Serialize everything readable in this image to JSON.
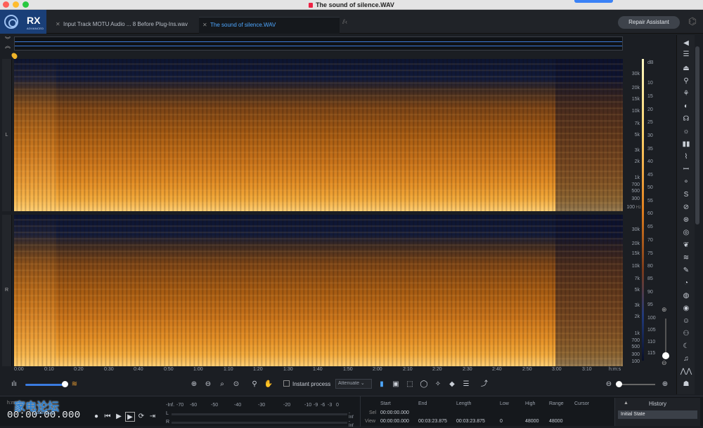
{
  "window": {
    "title": "The sound of silence.WAV"
  },
  "app": {
    "logo_text": "RX",
    "logo_sub": "ADVANCED"
  },
  "tabs": [
    {
      "label": "Input Track MOTU Audio ... 8 Before Plug-Ins.wav",
      "active": false
    },
    {
      "label": "The sound of silence.WAV",
      "active": true
    }
  ],
  "header": {
    "repair_assistant_label": "Repair Assistant"
  },
  "channels": {
    "left_label": "L",
    "right_label": "R"
  },
  "freq_scale_left": [
    "30k",
    "20k",
    "15k",
    "10k",
    "7k",
    "5k",
    "3k",
    "2k",
    "1k",
    "700",
    "500",
    "300",
    "100"
  ],
  "freq_scale_right": [
    "30k",
    "20k",
    "15k",
    "10k",
    "7k",
    "5k",
    "3k",
    "2k",
    "1k",
    "700",
    "500",
    "300",
    "100"
  ],
  "freq_unit": "Hz",
  "db_unit": "dB",
  "db_scale": [
    "10",
    "15",
    "20",
    "25",
    "30",
    "35",
    "40",
    "45",
    "50",
    "55",
    "60",
    "65",
    "70",
    "75",
    "80",
    "85",
    "90",
    "95",
    "100",
    "105",
    "110",
    "115"
  ],
  "time_ruler": [
    "0:00",
    "0:10",
    "0:20",
    "0:30",
    "0:40",
    "0:50",
    "1:00",
    "1:10",
    "1:20",
    "1:30",
    "1:40",
    "1:50",
    "2:00",
    "2:10",
    "2:20",
    "2:30",
    "2:40",
    "2:50",
    "3:00",
    "3:10"
  ],
  "time_unit": "h:m:s",
  "toolbar": {
    "instant_process_label": "Instant process",
    "attenuate_label": "Attenuate"
  },
  "transport": {
    "time_unit": "h:m:s",
    "timecode": "00:00:00.000"
  },
  "meter": {
    "scale": [
      "-Inf.",
      "-70",
      "-60",
      "-50",
      "-40",
      "-30",
      "-20",
      "-10",
      "-9",
      "-6",
      "-3",
      "0"
    ],
    "rows": [
      {
        "ch": "L",
        "peak": "-Inf"
      },
      {
        "ch": "R",
        "peak": "-Inf"
      }
    ]
  },
  "selection_info": {
    "headers": [
      "Start",
      "End",
      "Length",
      "Low",
      "High",
      "Range",
      "Cursor"
    ],
    "rows": [
      {
        "label": "Sel",
        "start": "00:00:00.000",
        "end": "",
        "length": "",
        "low": "",
        "high": "",
        "range": ""
      },
      {
        "label": "View",
        "start": "00:00:00.000",
        "end": "00:03:23.875",
        "length": "00:03:23.875",
        "low": "0",
        "high": "48000",
        "range": "48000"
      }
    ]
  },
  "history": {
    "title": "History",
    "items": [
      "Initial State"
    ]
  },
  "watermark": {
    "text": "家电论坛",
    "sub": "jdbbs.com"
  }
}
